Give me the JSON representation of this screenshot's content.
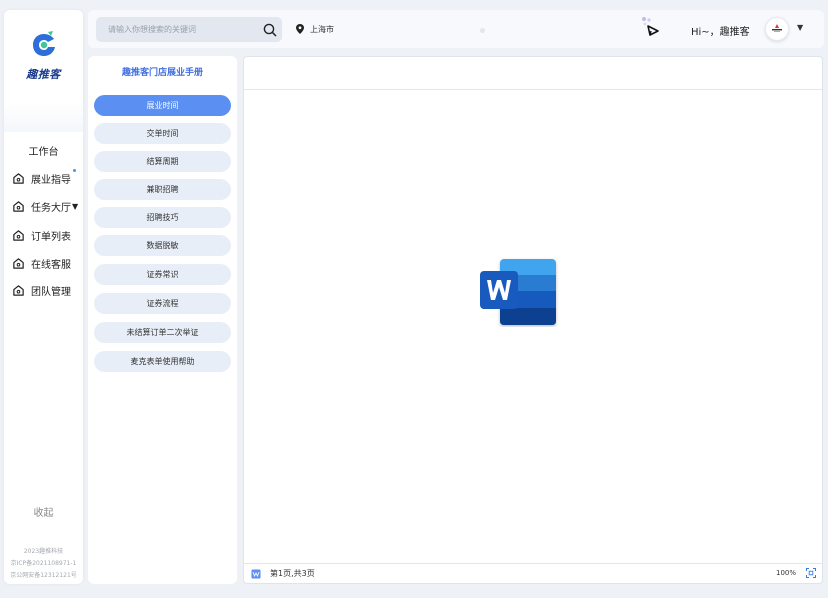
{
  "app": {
    "name": "趣推客",
    "brand_color": "#1a3b8f",
    "accent_color": "#5b8ff2"
  },
  "sidebar": {
    "workbench_label": "工作台",
    "items": [
      {
        "label": "展业指导",
        "icon": "home-icon",
        "has_dot": true
      },
      {
        "label": "任务大厅",
        "icon": "home-icon",
        "has_caret": true
      },
      {
        "label": "订单列表",
        "icon": "home-icon"
      },
      {
        "label": "在线客服",
        "icon": "home-icon"
      },
      {
        "label": "团队管理",
        "icon": "home-icon"
      }
    ],
    "collapse_label": "收起",
    "footer": [
      "2023趣推科技",
      "京ICP备2021108971-1",
      "京公网安备12312121号"
    ]
  },
  "header": {
    "search_placeholder": "请输入你想搜索的关键词",
    "location": "上海市",
    "greeting": "Hi~，趣推客"
  },
  "manual": {
    "title": "趣推客门店展业手册",
    "items": [
      {
        "label": "展业时间",
        "active": true
      },
      {
        "label": "交单时间"
      },
      {
        "label": "结算周期"
      },
      {
        "label": "兼职招聘"
      },
      {
        "label": "招聘技巧"
      },
      {
        "label": "数据脱敏"
      },
      {
        "label": "证券常识"
      },
      {
        "label": "证券流程"
      },
      {
        "label": "未结算订单二次举证"
      },
      {
        "label": "麦克表单使用帮助"
      }
    ]
  },
  "viewer": {
    "document_icon": "word-document-icon",
    "page_info": "第1页,共3页",
    "zoom": "100%"
  }
}
